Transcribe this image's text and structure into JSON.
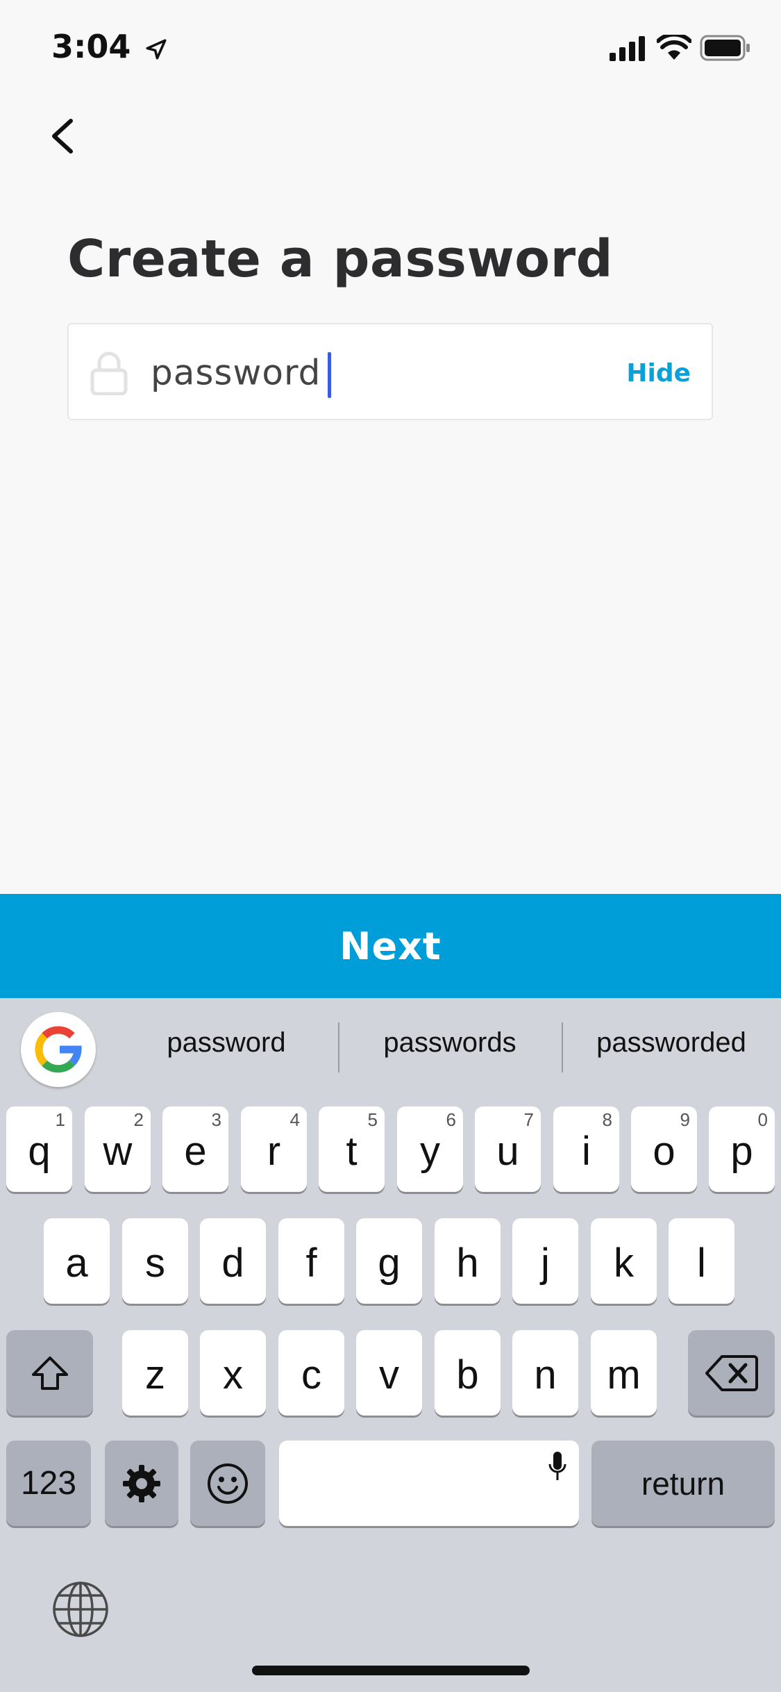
{
  "status_bar": {
    "time": "3:04"
  },
  "page": {
    "title": "Create a password",
    "password_field": {
      "value": "password",
      "toggle_label": "Hide"
    },
    "next_button": "Next"
  },
  "keyboard": {
    "suggestions": [
      "password",
      "passwords",
      "passworded"
    ],
    "row1": [
      {
        "ch": "q",
        "num": "1"
      },
      {
        "ch": "w",
        "num": "2"
      },
      {
        "ch": "e",
        "num": "3"
      },
      {
        "ch": "r",
        "num": "4"
      },
      {
        "ch": "t",
        "num": "5"
      },
      {
        "ch": "y",
        "num": "6"
      },
      {
        "ch": "u",
        "num": "7"
      },
      {
        "ch": "i",
        "num": "8"
      },
      {
        "ch": "o",
        "num": "9"
      },
      {
        "ch": "p",
        "num": "0"
      }
    ],
    "row2": [
      "a",
      "s",
      "d",
      "f",
      "g",
      "h",
      "j",
      "k",
      "l"
    ],
    "row3": [
      "z",
      "x",
      "c",
      "v",
      "b",
      "n",
      "m"
    ],
    "numbers_key": "123",
    "return_key": "return"
  },
  "colors": {
    "accent": "#009ed8",
    "link": "#0aa0d8",
    "caret": "#3b5bdb"
  }
}
